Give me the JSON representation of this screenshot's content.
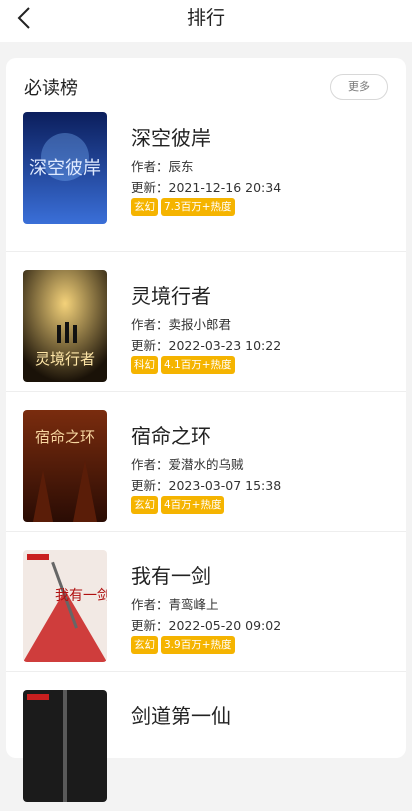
{
  "header": {
    "title": "排行"
  },
  "section": {
    "title": "必读榜",
    "more_label": "更多"
  },
  "labels": {
    "author_prefix": "作者：",
    "updated_prefix": "更新："
  },
  "books": [
    {
      "title": "深空彼岸",
      "author": "辰东",
      "updated": "2021-12-16 20:34",
      "genre": "玄幻",
      "heat": "7.3百万+热度",
      "cover_text": "深空彼岸",
      "cover_colors": [
        "#0b1e5c",
        "#3a6fd8"
      ]
    },
    {
      "title": "灵境行者",
      "author": "卖报小郎君",
      "updated": "2022-03-23 10:22",
      "genre": "科幻",
      "heat": "4.1百万+热度",
      "cover_text": "灵境行者",
      "cover_colors": [
        "#1a1208",
        "#e3b34a"
      ]
    },
    {
      "title": "宿命之环",
      "author": "爱潜水的乌贼",
      "updated": "2023-03-07 15:38",
      "genre": "玄幻",
      "heat": "4百万+热度",
      "cover_text": "宿命之环",
      "cover_colors": [
        "#3a1406",
        "#c0521c"
      ]
    },
    {
      "title": "我有一剑",
      "author": "青鸾峰上",
      "updated": "2022-05-20 09:02",
      "genre": "玄幻",
      "heat": "3.9百万+热度",
      "cover_text": "我有一剑",
      "cover_colors": [
        "#f2e9e4",
        "#c91f1f"
      ]
    },
    {
      "title": "剑道第一仙",
      "cover_colors": [
        "#1b1b1b",
        "#4a4a4a"
      ]
    }
  ]
}
